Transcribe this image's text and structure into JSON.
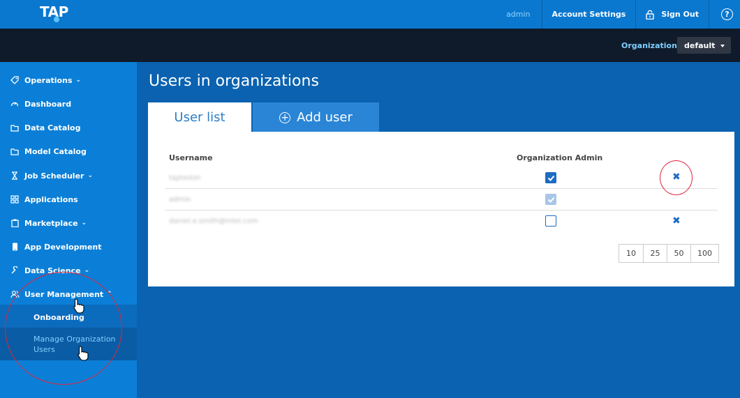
{
  "brand": {
    "logo": "TAP"
  },
  "topbar": {
    "user": "admin",
    "account_settings": "Account Settings",
    "sign_out": "Sign Out",
    "help": "?"
  },
  "org": {
    "label": "Organization:",
    "selected": "default"
  },
  "sidebar": {
    "items": [
      {
        "label": "Operations",
        "icon": "tag-icon",
        "chevron": "down"
      },
      {
        "label": "Dashboard",
        "icon": "gauge-icon"
      },
      {
        "label": "Data Catalog",
        "icon": "folder-icon"
      },
      {
        "label": "Model Catalog",
        "icon": "folder-icon"
      },
      {
        "label": "Job Scheduler",
        "icon": "hourglass-icon",
        "chevron": "down"
      },
      {
        "label": "Applications",
        "icon": "grid-icon"
      },
      {
        "label": "Marketplace",
        "icon": "clipboard-icon",
        "chevron": "down"
      },
      {
        "label": "App Development",
        "icon": "phone-icon"
      },
      {
        "label": "Data Science",
        "icon": "wrench-icon",
        "chevron": "down"
      },
      {
        "label": "User Management",
        "icon": "users-icon",
        "chevron": "up"
      }
    ],
    "submenu": [
      {
        "label": "Onboarding"
      },
      {
        "label": "Manage Organization Users",
        "line1": "Manage Organization",
        "line2": "Users",
        "active": true
      }
    ]
  },
  "main": {
    "title": "Users in organizations",
    "tabs": [
      {
        "label": "User list",
        "active": true
      },
      {
        "label": "Add user",
        "icon": "plus-circle-icon"
      }
    ],
    "table": {
      "columns": [
        "Username",
        "Organization Admin"
      ],
      "rows": [
        {
          "username": "taptester",
          "admin": true,
          "removable": true
        },
        {
          "username": "admin",
          "admin": true,
          "disabled": true,
          "removable": false
        },
        {
          "username": "daniel.e.smith@intel.com",
          "admin": false,
          "removable": true
        }
      ]
    },
    "page_sizes": [
      "10",
      "25",
      "50",
      "100"
    ]
  },
  "colors": {
    "topbar": "#0b78cf",
    "orgbar": "#0f1b2b",
    "sidebar": "#0b7fd7",
    "background": "#0a62b0",
    "accent": "#1d6bc4",
    "annotation": "#e0253c"
  }
}
